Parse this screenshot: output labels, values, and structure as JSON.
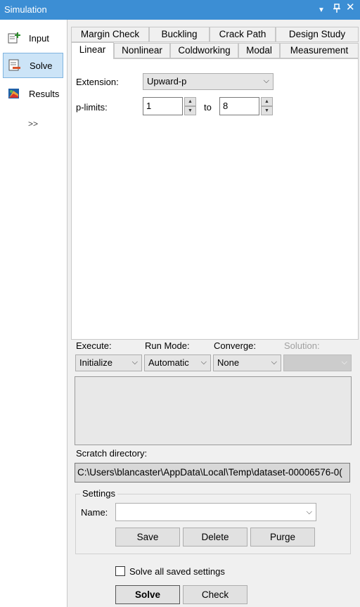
{
  "window": {
    "title": "Simulation"
  },
  "nav": {
    "items": [
      {
        "label": "Input"
      },
      {
        "label": "Solve"
      },
      {
        "label": "Results"
      }
    ],
    "more": ">>"
  },
  "tabs": {
    "row1": [
      "Margin Check",
      "Buckling",
      "Crack Path",
      "Design Study"
    ],
    "row2": [
      "Linear",
      "Nonlinear",
      "Coldworking",
      "Modal",
      "Measurement"
    ]
  },
  "linear": {
    "extension_label": "Extension:",
    "extension_value": "Upward-p",
    "plimits_label": "p-limits:",
    "plimits_from": "1",
    "to_label": "to",
    "plimits_to": "8"
  },
  "run": {
    "execute_label": "Execute:",
    "execute_value": "Initialize",
    "runmode_label": "Run Mode:",
    "runmode_value": "Automatic",
    "converge_label": "Converge:",
    "converge_value": "None",
    "solution_label": "Solution:",
    "solution_value": ""
  },
  "scratch": {
    "label": "Scratch directory:",
    "path": "C:\\Users\\blancaster\\AppData\\Local\\Temp\\dataset-00006576-0("
  },
  "settings": {
    "legend": "Settings",
    "name_label": "Name:",
    "name_value": "",
    "save": "Save",
    "delete": "Delete",
    "purge": "Purge"
  },
  "footer": {
    "solve_all_label": "Solve all saved settings",
    "solve": "Solve",
    "check": "Check"
  }
}
